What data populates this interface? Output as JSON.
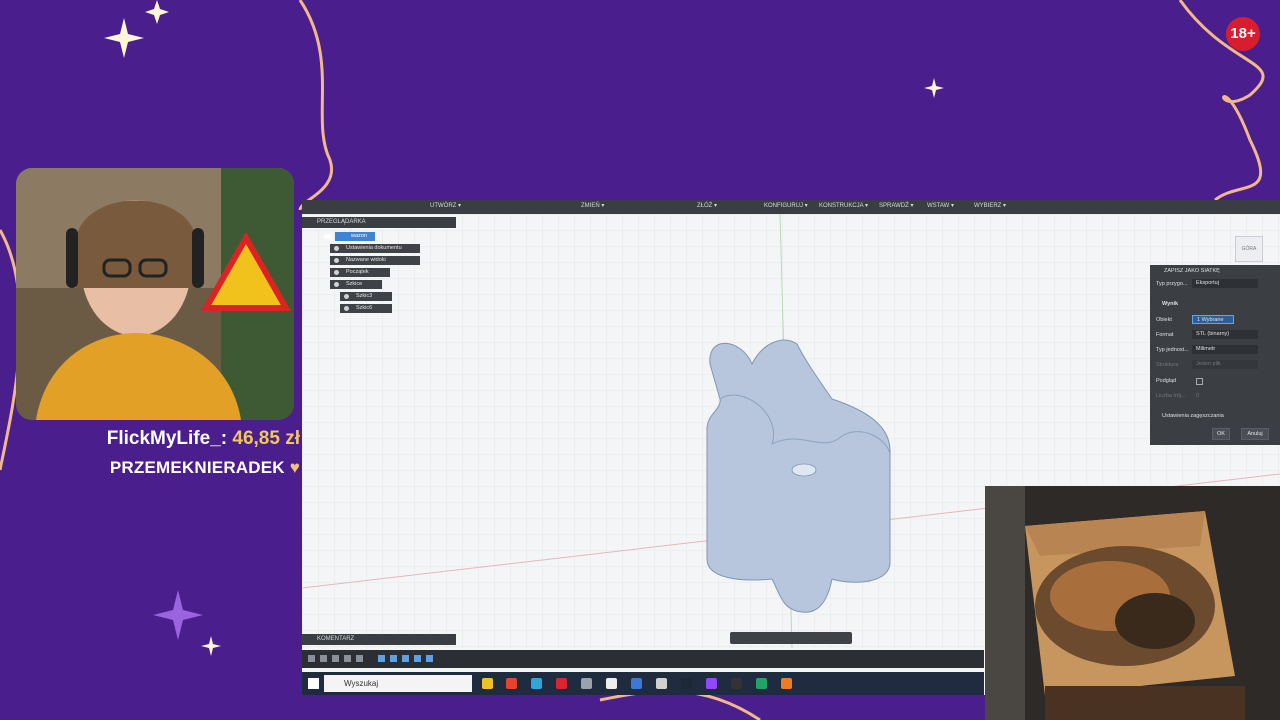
{
  "overlay": {
    "donation_user": "FlickMyLife_:",
    "donation_amount": "46,85 zł",
    "second_donor": "PRZEMEKNIERADEK",
    "heart": "♥",
    "age_badge": "18+"
  },
  "toolbar": {
    "menus": [
      "UTWÓRZ ▾",
      "ZMIEŃ ▾",
      "ZŁÓŻ ▾",
      "KONFIGURUJ ▾",
      "KONSTRUKCJA ▾",
      "SPRAWDŹ ▾",
      "WSTAW ▾",
      "WYBIERZ ▾"
    ]
  },
  "browser": {
    "title": "PRZEGLĄDARKA",
    "root": "wazon",
    "items": [
      "Ustawienia dokumentu",
      "Nazwane widoki",
      "Początek",
      "Szkice"
    ],
    "sketches": [
      "Szkic3",
      "Szkic6"
    ]
  },
  "viewcube": {
    "label": "GÓRA"
  },
  "dialog": {
    "title": "ZAPISZ JAKO SIATKĘ",
    "type_label": "Typ przygo...",
    "type_value": "Eksportuj",
    "section_result": "Wynik",
    "object_label": "Obiekt",
    "object_value": "1 Wybrane",
    "format_label": "Format",
    "format_value": "STL (binarny)",
    "unit_label": "Typ jednost...",
    "unit_value": "Milimetr",
    "structure_label": "Struktura",
    "structure_value": "Jeden plik",
    "preview_label": "Podgląd",
    "count_label": "Liczba trój...",
    "count_value": "0",
    "refine_label": "Ustawienia zagęszczania",
    "ok": "OK",
    "cancel": "Anuluj"
  },
  "comments": {
    "label": "KOMENTARZ"
  },
  "taskbar": {
    "search_placeholder": "Wyszukaj"
  }
}
